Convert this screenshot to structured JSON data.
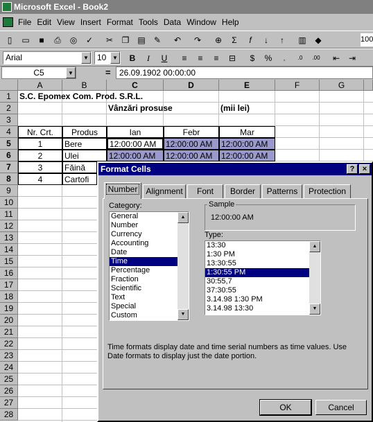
{
  "window": {
    "title": "Microsoft Excel - Book2"
  },
  "menu": [
    "File",
    "Edit",
    "View",
    "Insert",
    "Format",
    "Tools",
    "Data",
    "Window",
    "Help"
  ],
  "toolbar": {
    "font": "Arial",
    "size": "10",
    "zoom": "100"
  },
  "formula": {
    "cell_ref": "C5",
    "equals": "=",
    "content": "26.09.1902  00:00:00"
  },
  "columns": [
    "A",
    "B",
    "C",
    "D",
    "E",
    "F",
    "G"
  ],
  "rows": [
    "1",
    "2",
    "3",
    "4",
    "5",
    "6",
    "7",
    "8",
    "9",
    "10",
    "11",
    "12",
    "13",
    "14",
    "15",
    "16",
    "17",
    "18",
    "19",
    "20",
    "21",
    "22",
    "23",
    "24",
    "25",
    "26",
    "27",
    "28"
  ],
  "cells": {
    "r1a": "S.C. Epomex Com. Prod. S.R.L.",
    "r2c": "Vânzări prosuse",
    "r2e": "(mii lei)",
    "r4a": "Nr. Crt.",
    "r4b": "Produs",
    "r4c": "Ian",
    "r4d": "Febr",
    "r4e": "Mar",
    "r5a": "1",
    "r5b": "Bere",
    "r5c": "12:00:00 AM",
    "r5d": "12:00:00 AM",
    "r5e": "12:00:00 AM",
    "r6a": "2",
    "r6b": "Ulei",
    "r6c": "12:00:00 AM",
    "r6d": "12:00:00 AM",
    "r6e": "12:00:00 AM",
    "r7a": "3",
    "r7b": "Făină",
    "r8a": "4",
    "r8b": "Cartofi"
  },
  "dialog": {
    "title": "Format Cells",
    "help": "?",
    "close": "×",
    "tabs": [
      "Number",
      "Alignment",
      "Font",
      "Border",
      "Patterns",
      "Protection"
    ],
    "category_label": "Category:",
    "categories": [
      "General",
      "Number",
      "Currency",
      "Accounting",
      "Date",
      "Time",
      "Percentage",
      "Fraction",
      "Scientific",
      "Text",
      "Special",
      "Custom"
    ],
    "selected_category": "Time",
    "sample_label": "Sample",
    "sample_value": "12:00:00 AM",
    "type_label": "Type:",
    "types": [
      "13:30",
      "1:30 PM",
      "13:30:55",
      "1:30:55 PM",
      "30:55,7",
      "37:30:55",
      "3.14.98 1:30 PM",
      "3.14.98 13:30"
    ],
    "selected_type": "1:30:55 PM",
    "description": "Time formats display date and time serial numbers as time values.  Use Date formats to display just the date portion.",
    "ok": "OK",
    "cancel": "Cancel"
  },
  "colors": {
    "title_bg": "#000080",
    "selection": "#9999cc"
  }
}
